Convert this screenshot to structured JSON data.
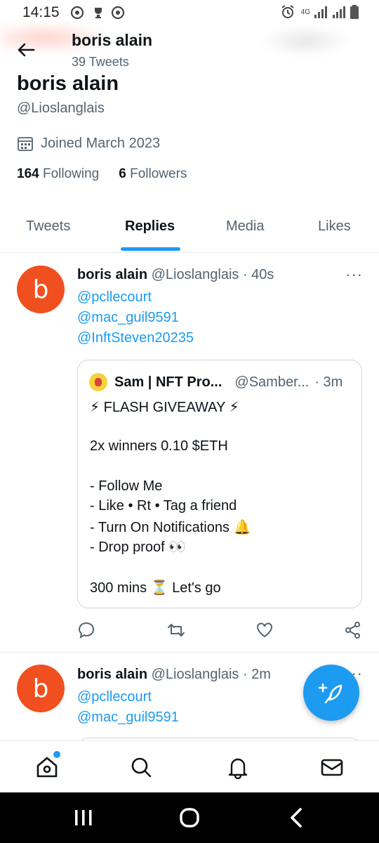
{
  "status_bar": {
    "time": "14:15",
    "network": "4G"
  },
  "header": {
    "name": "boris alain",
    "tweet_count": "39 Tweets"
  },
  "profile": {
    "name": "boris alain",
    "handle": "@Lioslanglais",
    "joined": "Joined March 2023",
    "following_count": "164",
    "following_label": "Following",
    "followers_count": "6",
    "followers_label": "Followers"
  },
  "tabs": [
    {
      "label": "Tweets"
    },
    {
      "label": "Replies"
    },
    {
      "label": "Media"
    },
    {
      "label": "Likes"
    }
  ],
  "tweets": [
    {
      "avatar_letter": "b",
      "name": "boris alain",
      "handle_time": "@Lioslanglais · 40s",
      "mentions": [
        "@pcllecourt",
        "@mac_guil9591",
        "@InftSteven20235"
      ],
      "quote": {
        "name": "Sam | NFT Pro...",
        "handle": "@Samber...",
        "time": "· 3m",
        "lines": [
          "⚡ FLASH GIVEAWAY ⚡",
          "2x winners 0.10 $ETH",
          "- Follow Me",
          "- Like • Rt • Tag a friend",
          "- Turn On Notifications 🔔",
          "- Drop proof 👀",
          "300 mins  ⏳ Let's go"
        ]
      }
    },
    {
      "avatar_letter": "b",
      "name": "boris alain",
      "handle_time": "@Lioslanglais · 2m",
      "mentions": [
        "@pcllecourt",
        "@mac_guil9591"
      ]
    }
  ],
  "more_glyph": "···",
  "colors": {
    "accent": "#1d9bf0",
    "avatar": "#f0501f",
    "secondary_text": "#536471"
  }
}
